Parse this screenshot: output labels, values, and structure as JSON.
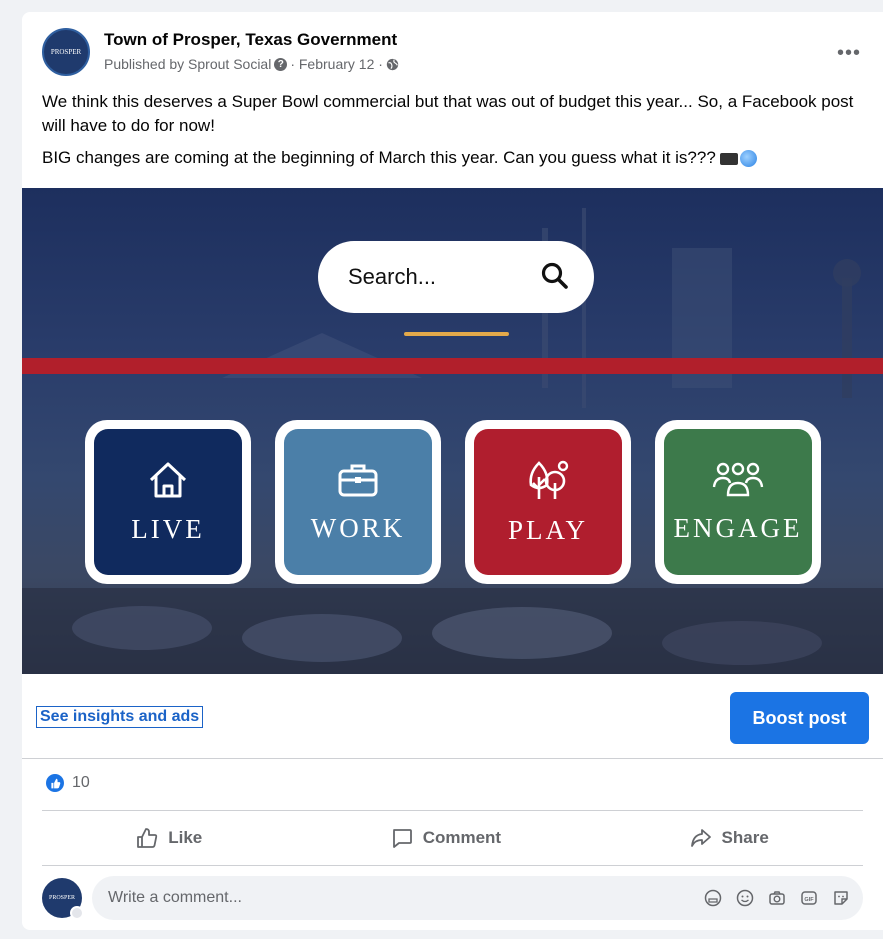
{
  "post": {
    "page_name": "Town of Prosper, Texas Government",
    "published_by": "Published by Sprout Social",
    "date": "· February 12 ·",
    "avatar_text": "PROSPER",
    "more_label": "•••",
    "text_line1": "We think this deserves a Super Bowl commercial but that was out of budget this year... So, a Facebook post will have to do for now!",
    "text_line2": "BIG changes are coming at the beginning of March this year. Can you guess what it is???"
  },
  "image": {
    "search_placeholder": "Search...",
    "tiles": [
      {
        "label": "LIVE",
        "color": "#102a5e",
        "icon": "house-icon"
      },
      {
        "label": "WORK",
        "color": "#4b7fa8",
        "icon": "briefcase-icon"
      },
      {
        "label": "PLAY",
        "color": "#b01e2e",
        "icon": "trees-icon"
      },
      {
        "label": "ENGAGE",
        "color": "#3d7a4b",
        "icon": "people-icon"
      }
    ]
  },
  "cta": {
    "insights_label": "See insights and ads",
    "boost_label": "Boost post"
  },
  "reactions": {
    "count": "10"
  },
  "actions": {
    "like": "Like",
    "comment": "Comment",
    "share": "Share"
  },
  "comment_box": {
    "placeholder": "Write a comment..."
  },
  "colors": {
    "accent": "#1b74e4",
    "red_band": "#b11f2b",
    "gold": "#e3a94a"
  }
}
